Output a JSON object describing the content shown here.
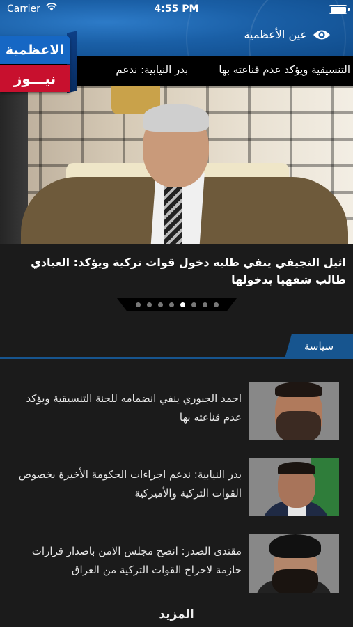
{
  "status_bar": {
    "carrier": "Carrier",
    "time": "4:55 PM"
  },
  "nav": {
    "title": "عين الأعظمية"
  },
  "logo": {
    "top_text": "الاعظمية",
    "bottom_text": "نيـــوز"
  },
  "ticker": {
    "items": [
      "التنسيقية ويؤكد عدم قناعته بها",
      "بدر النيابية: ندعم"
    ]
  },
  "featured": {
    "caption": "اثيل النجيفي ينفي طلبه دخول قوات تركية ويؤكد: العبادي طالب شفهيا بدخولها",
    "page_count": 8,
    "active_page": 5
  },
  "section": {
    "title": "سياسة"
  },
  "articles": [
    {
      "title": "احمد الجبوري ينفي انضمامه للجنة التنسيقية ويؤكد عدم قناعته بها"
    },
    {
      "title": "بدر النيابية: ندعم اجراءات الحكومة الأخيرة بخصوص القوات التركية والأميركية"
    },
    {
      "title": "مقتدى الصدر: انصح مجلس الامن باصدار قرارات حازمة لاخراج القوات التركية من العراق"
    }
  ],
  "more_label": "المزيد",
  "colors": {
    "nav_blue": "#1a5fa6",
    "logo_blue": "#1667c4",
    "logo_red": "#c8102e",
    "section_blue": "#17558f",
    "background": "#1b1b1b"
  }
}
